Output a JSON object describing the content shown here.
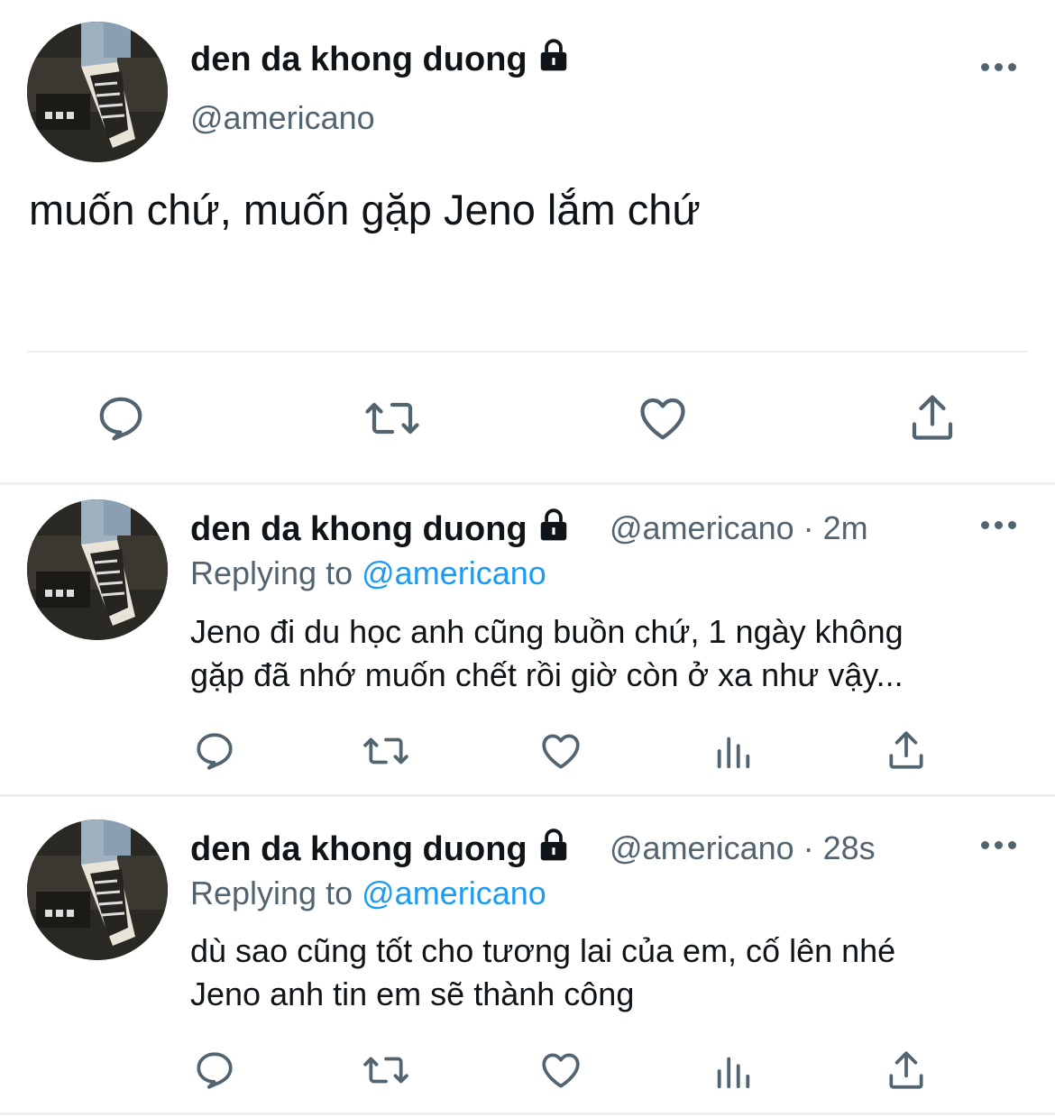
{
  "main_tweet": {
    "display_name": "den da khong duong",
    "handle": "@americano",
    "text": "muốn chứ, muốn gặp Jeno lắm chứ",
    "actions": [
      "reply-icon",
      "retweet-icon",
      "like-icon",
      "share-icon"
    ]
  },
  "replies": [
    {
      "display_name": "den da khong duong",
      "meta": "@americano · 2m",
      "replying_label": "Replying to",
      "replying_handle": "@americano",
      "line1": "Jeno đi du học anh cũng buồn chứ, 1 ngày không",
      "line2": "gặp đã nhớ muốn chết rồi giờ còn ở xa như vậy..."
    },
    {
      "display_name": "den da khong duong",
      "meta": "@americano · 28s",
      "replying_label": "Replying to",
      "replying_handle": "@americano",
      "line1": "dù sao cũng tốt cho tương lai của em, cố lên nhé",
      "line2": "Jeno anh tin em sẽ thành công"
    }
  ],
  "colors": {
    "text": "#0f1419",
    "secondary": "#536471",
    "link": "#1d9bf0",
    "divider": "#eceef0"
  }
}
